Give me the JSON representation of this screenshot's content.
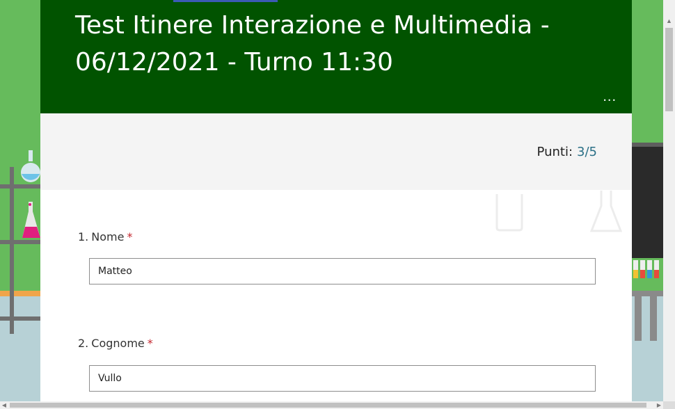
{
  "form": {
    "title": "Test Itinere Interazione e Multimedia - 06/12/2021 - Turno 11:30",
    "more_label": "...",
    "score_label": "Punti:",
    "score_value": "3/5"
  },
  "questions": [
    {
      "number": "1.",
      "label": "Nome",
      "required_mark": "*",
      "answer": "Matteo"
    },
    {
      "number": "2.",
      "label": "Cognome",
      "required_mark": "*",
      "answer": "Vullo"
    }
  ],
  "colors": {
    "header": "#015300",
    "background": "#66bb5c",
    "score_value": "#2a6f86",
    "required": "#c4262e"
  }
}
